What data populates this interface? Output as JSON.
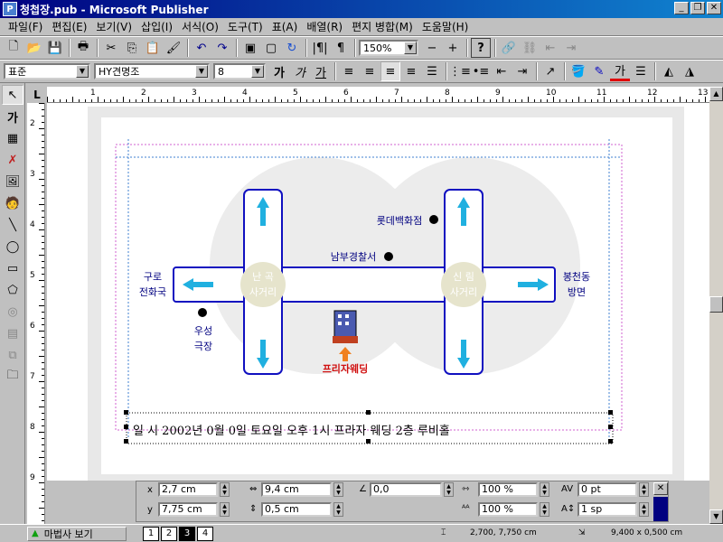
{
  "window": {
    "title": "청첩장.pub - Microsoft Publisher",
    "app_icon": "publisher-icon"
  },
  "menu": [
    "파일(F)",
    "편집(E)",
    "보기(V)",
    "삽입(I)",
    "서식(O)",
    "도구(T)",
    "표(A)",
    "배열(R)",
    "편지 병합(M)",
    "도움말(H)"
  ],
  "toolbar": {
    "zoom": "150%",
    "zoom_out": "−",
    "zoom_in": "+",
    "help": "?"
  },
  "format": {
    "style": "표준",
    "font": "HY견명조",
    "size": "8",
    "ga1": "가",
    "ga2": "가",
    "ga3": "가",
    "ga_color": "가"
  },
  "ruler": {
    "corner": "L",
    "h_marks": [
      "1",
      "2",
      "3",
      "4",
      "5",
      "6",
      "7",
      "8",
      "9",
      "10",
      "11",
      "12",
      "13"
    ],
    "v_marks": [
      "2",
      "3",
      "4",
      "5",
      "6",
      "7",
      "8",
      "9"
    ]
  },
  "map": {
    "left_dest": "구로\n전화국",
    "right_dest": "봉천동\n방면",
    "left_intersection": "난 곡\n사거리",
    "right_intersection": "신 림\n사거리",
    "lotte": "롯데백화점",
    "police": "남부경찰서",
    "post": "우성\n극장",
    "venue": "프리자웨딩"
  },
  "invitation_line": "일 시 2002년 0월 0일  토요일 오후 1시   프라자 웨딩 2층 루비홀",
  "measurements": {
    "x_label": "x",
    "x_value": "2,7 cm",
    "y_label": "y",
    "y_value": "7,75 cm",
    "w_value": "9,4 cm",
    "h_value": "0,5 cm",
    "angle_value": "0,0",
    "scale_w": "100 %",
    "scale_h": "100 %",
    "spacing": "0 pt",
    "line_spacing": "1 sp"
  },
  "status": {
    "wizard": "마법사 보기",
    "pages": [
      "1",
      "2",
      "3",
      "4"
    ],
    "current_page": "3",
    "position": "2,700, 7,750 cm",
    "size": "9,400 x 0,500 cm"
  }
}
